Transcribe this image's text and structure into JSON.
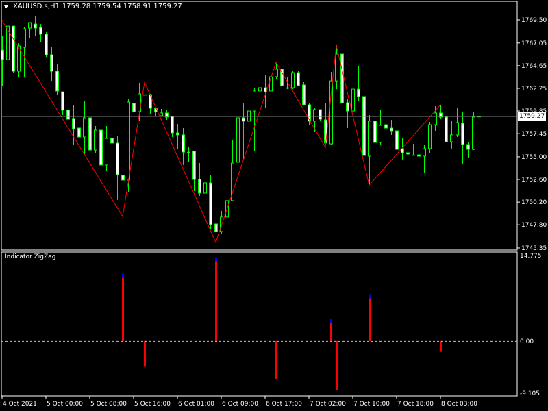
{
  "header": {
    "symbol": "XAUUSD.s,H1",
    "ohlc": "1759.28 1759.54 1758.91 1759.27"
  },
  "colors": {
    "background": "#000000",
    "candle_outline": "#00ff00",
    "bear_fill": "#ffffff",
    "bull_fill": "#000000",
    "zigzag": "#ff0000",
    "bid_line": "#808080",
    "ind_up": "#ff0000",
    "ind_tip": "#0000ff",
    "ind_down": "#ff0000"
  },
  "bid": {
    "label": "1759.27",
    "price": 1759.27
  },
  "indicator": {
    "title": "Indicator ZigZag",
    "scale_labels": [
      "14.775",
      "0.00",
      "-9.105"
    ]
  },
  "chart_data": [
    {
      "type": "candlestick",
      "title": "XAUUSD.s,H1",
      "ylim": [
        1745.13,
        1771.46
      ],
      "y_ticks": [
        "1769.50",
        "1767.05",
        "1764.65",
        "1762.25",
        "1759.85",
        "1757.45",
        "1755.00",
        "1752.60",
        "1750.20",
        "1747.80",
        "1745.35"
      ],
      "x_ticks": [
        {
          "bar": 0,
          "label": "4 Oct 2021"
        },
        {
          "bar": 8,
          "label": "5 Oct 00:00"
        },
        {
          "bar": 16,
          "label": "5 Oct 08:00"
        },
        {
          "bar": 24,
          "label": "5 Oct 16:00"
        },
        {
          "bar": 32,
          "label": "6 Oct 01:00"
        },
        {
          "bar": 40,
          "label": "6 Oct 09:00"
        },
        {
          "bar": 48,
          "label": "6 Oct 17:00"
        },
        {
          "bar": 56,
          "label": "7 Oct 02:00"
        },
        {
          "bar": 64,
          "label": "7 Oct 10:00"
        },
        {
          "bar": 72,
          "label": "7 Oct 18:00"
        },
        {
          "bar": 80,
          "label": "8 Oct 03:00"
        }
      ],
      "ohlc": [
        [
          1766.31,
          1767.76,
          1762.54,
          1765.29
        ],
        [
          1765.29,
          1770.08,
          1764.93,
          1768.84
        ],
        [
          1768.84,
          1768.84,
          1763.84,
          1764.06
        ],
        [
          1764.06,
          1767.03,
          1763.48,
          1766.74
        ],
        [
          1766.6,
          1768.7,
          1763.48,
          1768.55
        ],
        [
          1768.63,
          1769.21,
          1767.54,
          1769.21
        ],
        [
          1769.06,
          1769.86,
          1767.83,
          1768.63
        ],
        [
          1768.7,
          1769.06,
          1767.18,
          1767.97
        ],
        [
          1767.97,
          1768.19,
          1765.58,
          1765.8
        ],
        [
          1765.8,
          1766.6,
          1763.04,
          1764.06
        ],
        [
          1764.06,
          1764.86,
          1761.59,
          1761.96
        ],
        [
          1761.88,
          1761.88,
          1759.42,
          1759.93
        ],
        [
          1759.93,
          1760.07,
          1757.68,
          1758.98
        ],
        [
          1759.06,
          1760.51,
          1756.23,
          1757.97
        ],
        [
          1758.04,
          1759.27,
          1755.14,
          1757.1
        ],
        [
          1757.1,
          1760.87,
          1755.14,
          1759.13
        ],
        [
          1759.13,
          1760.07,
          1755.29,
          1755.72
        ],
        [
          1755.72,
          1758.26,
          1755.36,
          1757.82
        ],
        [
          1757.82,
          1758.11,
          1754.05,
          1754.13
        ],
        [
          1754.13,
          1758.26,
          1753.47,
          1756.95
        ],
        [
          1756.95,
          1761.38,
          1755.72,
          1756.45
        ],
        [
          1756.45,
          1757.17,
          1750.43,
          1753.11
        ],
        [
          1753.04,
          1754.2,
          1748.62,
          1752.53
        ],
        [
          1752.53,
          1761.16,
          1751.23,
          1760.8
        ],
        [
          1760.65,
          1761.16,
          1757.82,
          1759.78
        ],
        [
          1759.78,
          1762.83,
          1758.77,
          1761.67
        ],
        [
          1761.59,
          1762.68,
          1761.01,
          1761.59
        ],
        [
          1761.59,
          1761.67,
          1759.49,
          1760.14
        ],
        [
          1760.14,
          1760.22,
          1759.35,
          1759.78
        ],
        [
          1759.35,
          1760.07,
          1759.27,
          1759.64
        ],
        [
          1759.64,
          1760.0,
          1758.91,
          1759.2
        ],
        [
          1759.27,
          1759.35,
          1757.1,
          1757.53
        ],
        [
          1757.53,
          1758.48,
          1755.79,
          1757.32
        ],
        [
          1757.32,
          1758.04,
          1754.13,
          1755.5
        ],
        [
          1755.5,
          1756.01,
          1754.42,
          1755.5
        ],
        [
          1755.58,
          1755.65,
          1751.37,
          1752.6
        ],
        [
          1752.6,
          1754.34,
          1750.86,
          1751.15
        ],
        [
          1751.15,
          1754.71,
          1750.43,
          1752.24
        ],
        [
          1752.24,
          1753.04,
          1747.31,
          1747.82
        ],
        [
          1747.89,
          1749.99,
          1745.93,
          1747.09
        ],
        [
          1747.09,
          1749.27,
          1746.8,
          1748.62
        ],
        [
          1748.62,
          1750.79,
          1747.96,
          1750.36
        ],
        [
          1750.36,
          1756.81,
          1750.36,
          1754.34
        ],
        [
          1754.42,
          1761.23,
          1753.47,
          1759.13
        ],
        [
          1759.13,
          1760.72,
          1754.78,
          1758.77
        ],
        [
          1758.77,
          1764.2,
          1757.17,
          1759.85
        ],
        [
          1759.85,
          1762.25,
          1755.65,
          1761.96
        ],
        [
          1761.96,
          1763.12,
          1760.58,
          1762.32
        ],
        [
          1762.32,
          1763.62,
          1760.22,
          1761.88
        ],
        [
          1761.96,
          1764.42,
          1761.59,
          1763.48
        ],
        [
          1763.48,
          1765.07,
          1763.26,
          1764.28
        ],
        [
          1764.28,
          1764.71,
          1762.32,
          1762.54
        ],
        [
          1762.32,
          1763.48,
          1762.17,
          1762.32
        ],
        [
          1762.32,
          1764.06,
          1762.17,
          1763.91
        ],
        [
          1763.91,
          1764.13,
          1762.46,
          1762.54
        ],
        [
          1762.61,
          1762.97,
          1760.51,
          1760.51
        ],
        [
          1760.51,
          1760.72,
          1758.33,
          1758.77
        ],
        [
          1758.77,
          1760.14,
          1757.68,
          1760.0
        ],
        [
          1760.0,
          1760.0,
          1758.77,
          1758.98
        ],
        [
          1758.91,
          1760.72,
          1756.45,
          1756.45
        ],
        [
          1756.37,
          1763.99,
          1756.23,
          1763.04
        ],
        [
          1763.04,
          1766.81,
          1762.17,
          1765.87
        ],
        [
          1765.87,
          1766.02,
          1760.22,
          1760.72
        ],
        [
          1760.72,
          1761.09,
          1758.04,
          1759.85
        ],
        [
          1759.85,
          1762.46,
          1759.64,
          1762.17
        ],
        [
          1762.17,
          1764.57,
          1760.94,
          1761.38
        ],
        [
          1761.38,
          1762.83,
          1753.98,
          1755.14
        ],
        [
          1755.07,
          1759.42,
          1752.02,
          1758.77
        ],
        [
          1758.77,
          1763.12,
          1756.16,
          1756.52
        ],
        [
          1756.52,
          1759.93,
          1756.23,
          1758.33
        ],
        [
          1758.4,
          1759.78,
          1756.95,
          1758.04
        ],
        [
          1758.04,
          1758.91,
          1757.32,
          1757.75
        ],
        [
          1757.75,
          1757.9,
          1755.5,
          1755.79
        ],
        [
          1755.87,
          1757.03,
          1754.71,
          1755.43
        ],
        [
          1755.43,
          1758.04,
          1754.27,
          1755.29
        ],
        [
          1755.21,
          1756.37,
          1755.14,
          1755.21
        ],
        [
          1755.21,
          1755.36,
          1754.42,
          1755.07
        ],
        [
          1755.07,
          1756.23,
          1753.26,
          1755.87
        ],
        [
          1755.87,
          1758.69,
          1755.36,
          1758.4
        ],
        [
          1758.4,
          1760.36,
          1757.75,
          1759.64
        ],
        [
          1759.64,
          1760.51,
          1758.98,
          1759.2
        ],
        [
          1759.2,
          1759.27,
          1756.59,
          1756.59
        ],
        [
          1756.59,
          1758.77,
          1755.87,
          1757.32
        ],
        [
          1757.32,
          1760.22,
          1757.1,
          1758.62
        ],
        [
          1758.55,
          1759.71,
          1754.27,
          1756.3
        ],
        [
          1756.3,
          1756.52,
          1754.85,
          1755.79
        ],
        [
          1755.79,
          1759.71,
          1755.72,
          1759.2
        ],
        [
          1759.28,
          1759.54,
          1758.91,
          1759.27
        ]
      ],
      "zigzag": [
        {
          "bar": 0,
          "price": 1769.43
        },
        {
          "bar": 22,
          "price": 1748.69
        },
        {
          "bar": 26,
          "price": 1762.9
        },
        {
          "bar": 39,
          "price": 1745.93
        },
        {
          "bar": 50,
          "price": 1765.0
        },
        {
          "bar": 59,
          "price": 1756.0
        },
        {
          "bar": 61,
          "price": 1766.8
        },
        {
          "bar": 67,
          "price": 1752.0
        },
        {
          "bar": 80,
          "price": 1760.5
        }
      ]
    },
    {
      "type": "bar",
      "title": "Indicator ZigZag",
      "ylim": [
        -9.105,
        14.775
      ],
      "bars": [
        {
          "bar": 22,
          "value": 11.07
        },
        {
          "bar": 26,
          "value": -4.26
        },
        {
          "bar": 39,
          "value": 13.8
        },
        {
          "bar": 50,
          "value": -6.33
        },
        {
          "bar": 60,
          "value": 3.54
        },
        {
          "bar": 61,
          "value": -8.16
        },
        {
          "bar": 67,
          "value": 7.66
        },
        {
          "bar": 80,
          "value": -1.79
        }
      ]
    }
  ]
}
